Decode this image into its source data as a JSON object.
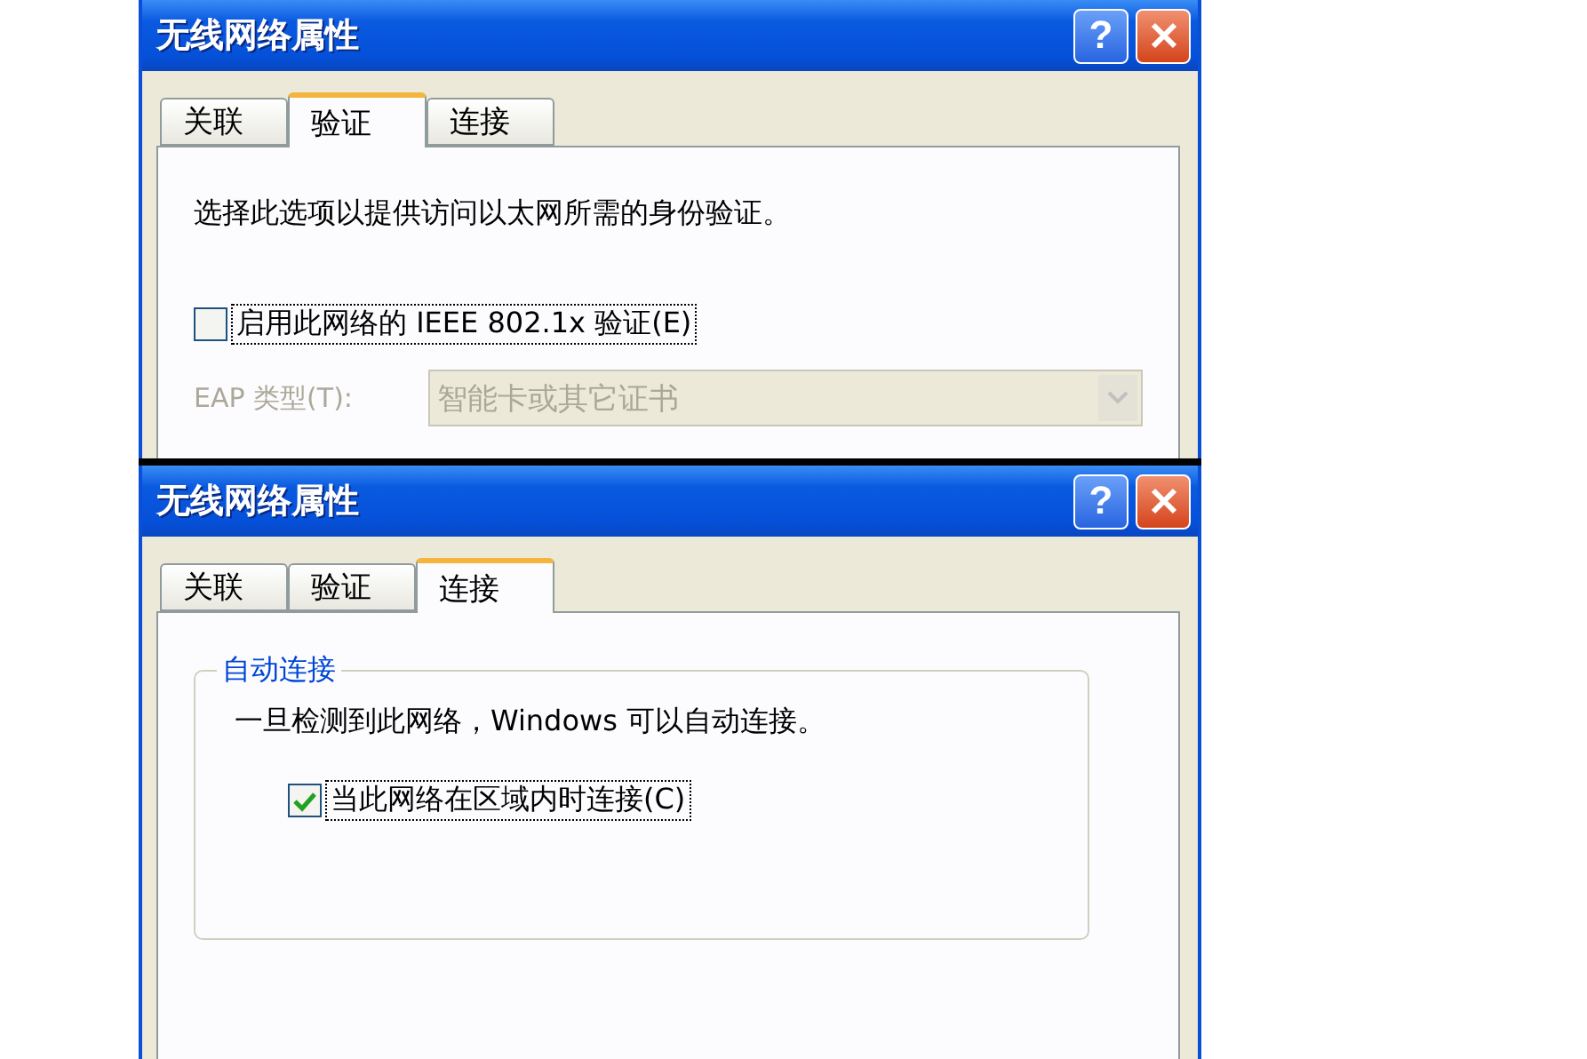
{
  "dialogs": [
    {
      "kind": "authentication",
      "title": "无线网络属性",
      "help_button": "?",
      "tabs": [
        {
          "label": "关联",
          "selected": false
        },
        {
          "label": "验证",
          "selected": true
        },
        {
          "label": "连接",
          "selected": false
        }
      ],
      "description": "选择此选项以提供访问以太网所需的身份验证。",
      "checkbox": {
        "label": "启用此网络的 IEEE 802.1x 验证(E)",
        "checked": false
      },
      "eap_type": {
        "label": "EAP 类型(T):",
        "value": "智能卡或其它证书",
        "disabled": true
      }
    },
    {
      "kind": "connection",
      "title": "无线网络属性",
      "help_button": "?",
      "tabs": [
        {
          "label": "关联",
          "selected": false
        },
        {
          "label": "验证",
          "selected": false
        },
        {
          "label": "连接",
          "selected": true
        }
      ],
      "group_title": "自动连接",
      "description": "一旦检测到此网络，Windows 可以自动连接。",
      "checkbox": {
        "label": "当此网络在区域内时连接(C)",
        "checked": true
      }
    }
  ]
}
